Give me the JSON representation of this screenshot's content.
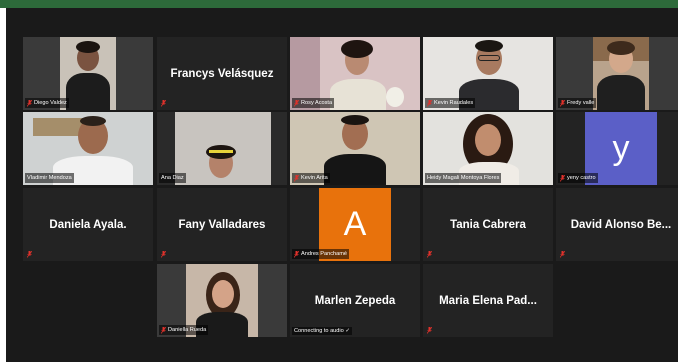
{
  "window": {
    "top_bar_color": "#2d6a3a",
    "background_color": "#1a1a1a",
    "tile_color": "#232323",
    "active_speaker_color": "#c6e84a"
  },
  "participants": [
    {
      "id": "diego",
      "label": "Diego Valdez",
      "type": "video",
      "muted": true
    },
    {
      "id": "francys",
      "label": "Francys Velásquez",
      "type": "name",
      "muted": true
    },
    {
      "id": "rosy",
      "label": "Rosy Acosta",
      "type": "video",
      "muted": true
    },
    {
      "id": "kevin_r",
      "label": "Kevin Raudales",
      "type": "video",
      "muted": true
    },
    {
      "id": "fredy",
      "label": "Fredy valle",
      "type": "video",
      "muted": true
    },
    {
      "id": "vladimir",
      "label": "Vladimir Mendoza",
      "type": "video",
      "muted": false,
      "active": true
    },
    {
      "id": "ana",
      "label": "Ana Diaz",
      "type": "video",
      "muted": false
    },
    {
      "id": "kevin_a",
      "label": "Kevin Arita",
      "type": "video",
      "muted": true
    },
    {
      "id": "heidy",
      "label": "Heidy Magali Montoya Flores",
      "type": "video",
      "muted": false
    },
    {
      "id": "yeny",
      "label": "yeny castro",
      "type": "avatar",
      "avatar_letter": "y",
      "avatar_color": "#5b5fc7",
      "muted": true
    },
    {
      "id": "daniela_a",
      "label": "Daniela Ayala.",
      "type": "name",
      "muted": true
    },
    {
      "id": "fany",
      "label": "Fany Valladares",
      "type": "name",
      "muted": true
    },
    {
      "id": "andres",
      "label": "Andres Panchamé",
      "type": "avatar",
      "avatar_letter": "A",
      "avatar_color": "#e8720c",
      "muted": true
    },
    {
      "id": "tania",
      "label": "Tania Cabrera",
      "type": "name",
      "muted": true
    },
    {
      "id": "david",
      "label": "David Alonso Be...",
      "type": "name",
      "muted": true
    },
    {
      "id": "daniella_r",
      "label": "Daniella Rueda",
      "type": "video",
      "muted": true
    },
    {
      "id": "marlen",
      "label": "Marlen Zepeda",
      "type": "name",
      "muted": false,
      "status": "Connecting to audio ✓"
    },
    {
      "id": "maria",
      "label": "Maria Elena Pad...",
      "type": "name",
      "muted": true
    }
  ]
}
